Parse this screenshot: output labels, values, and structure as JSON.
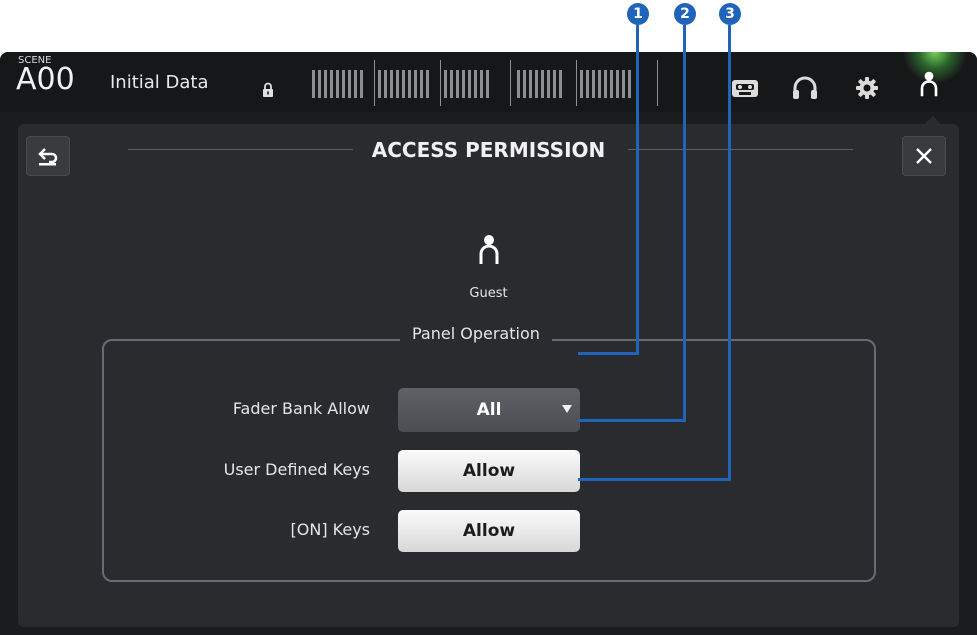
{
  "callouts": [
    "1",
    "2",
    "3"
  ],
  "header": {
    "scene_label": "SCENE",
    "scene_number": "A00",
    "scene_title": "Initial Data",
    "icons": [
      "lock-icon",
      "recorder-icon",
      "headphones-icon",
      "gear-icon",
      "user-icon"
    ]
  },
  "panel": {
    "title": "ACCESS PERMISSION",
    "back_icon": "return-icon",
    "close_icon": "close-icon",
    "user_name": "Guest",
    "group_title": "Panel Operation",
    "rows": [
      {
        "label": "Fader Bank Allow",
        "value": "All",
        "control": "dropdown"
      },
      {
        "label": "User Defined Keys",
        "value": "Allow",
        "control": "button"
      },
      {
        "label": "[ON] Keys",
        "value": "Allow",
        "control": "button"
      }
    ]
  },
  "colors": {
    "callout": "#1f64b8",
    "screen_bg": "#1b1c1e",
    "panel_bg": "#2a2b2e",
    "active_glow": "#78dc5a"
  }
}
